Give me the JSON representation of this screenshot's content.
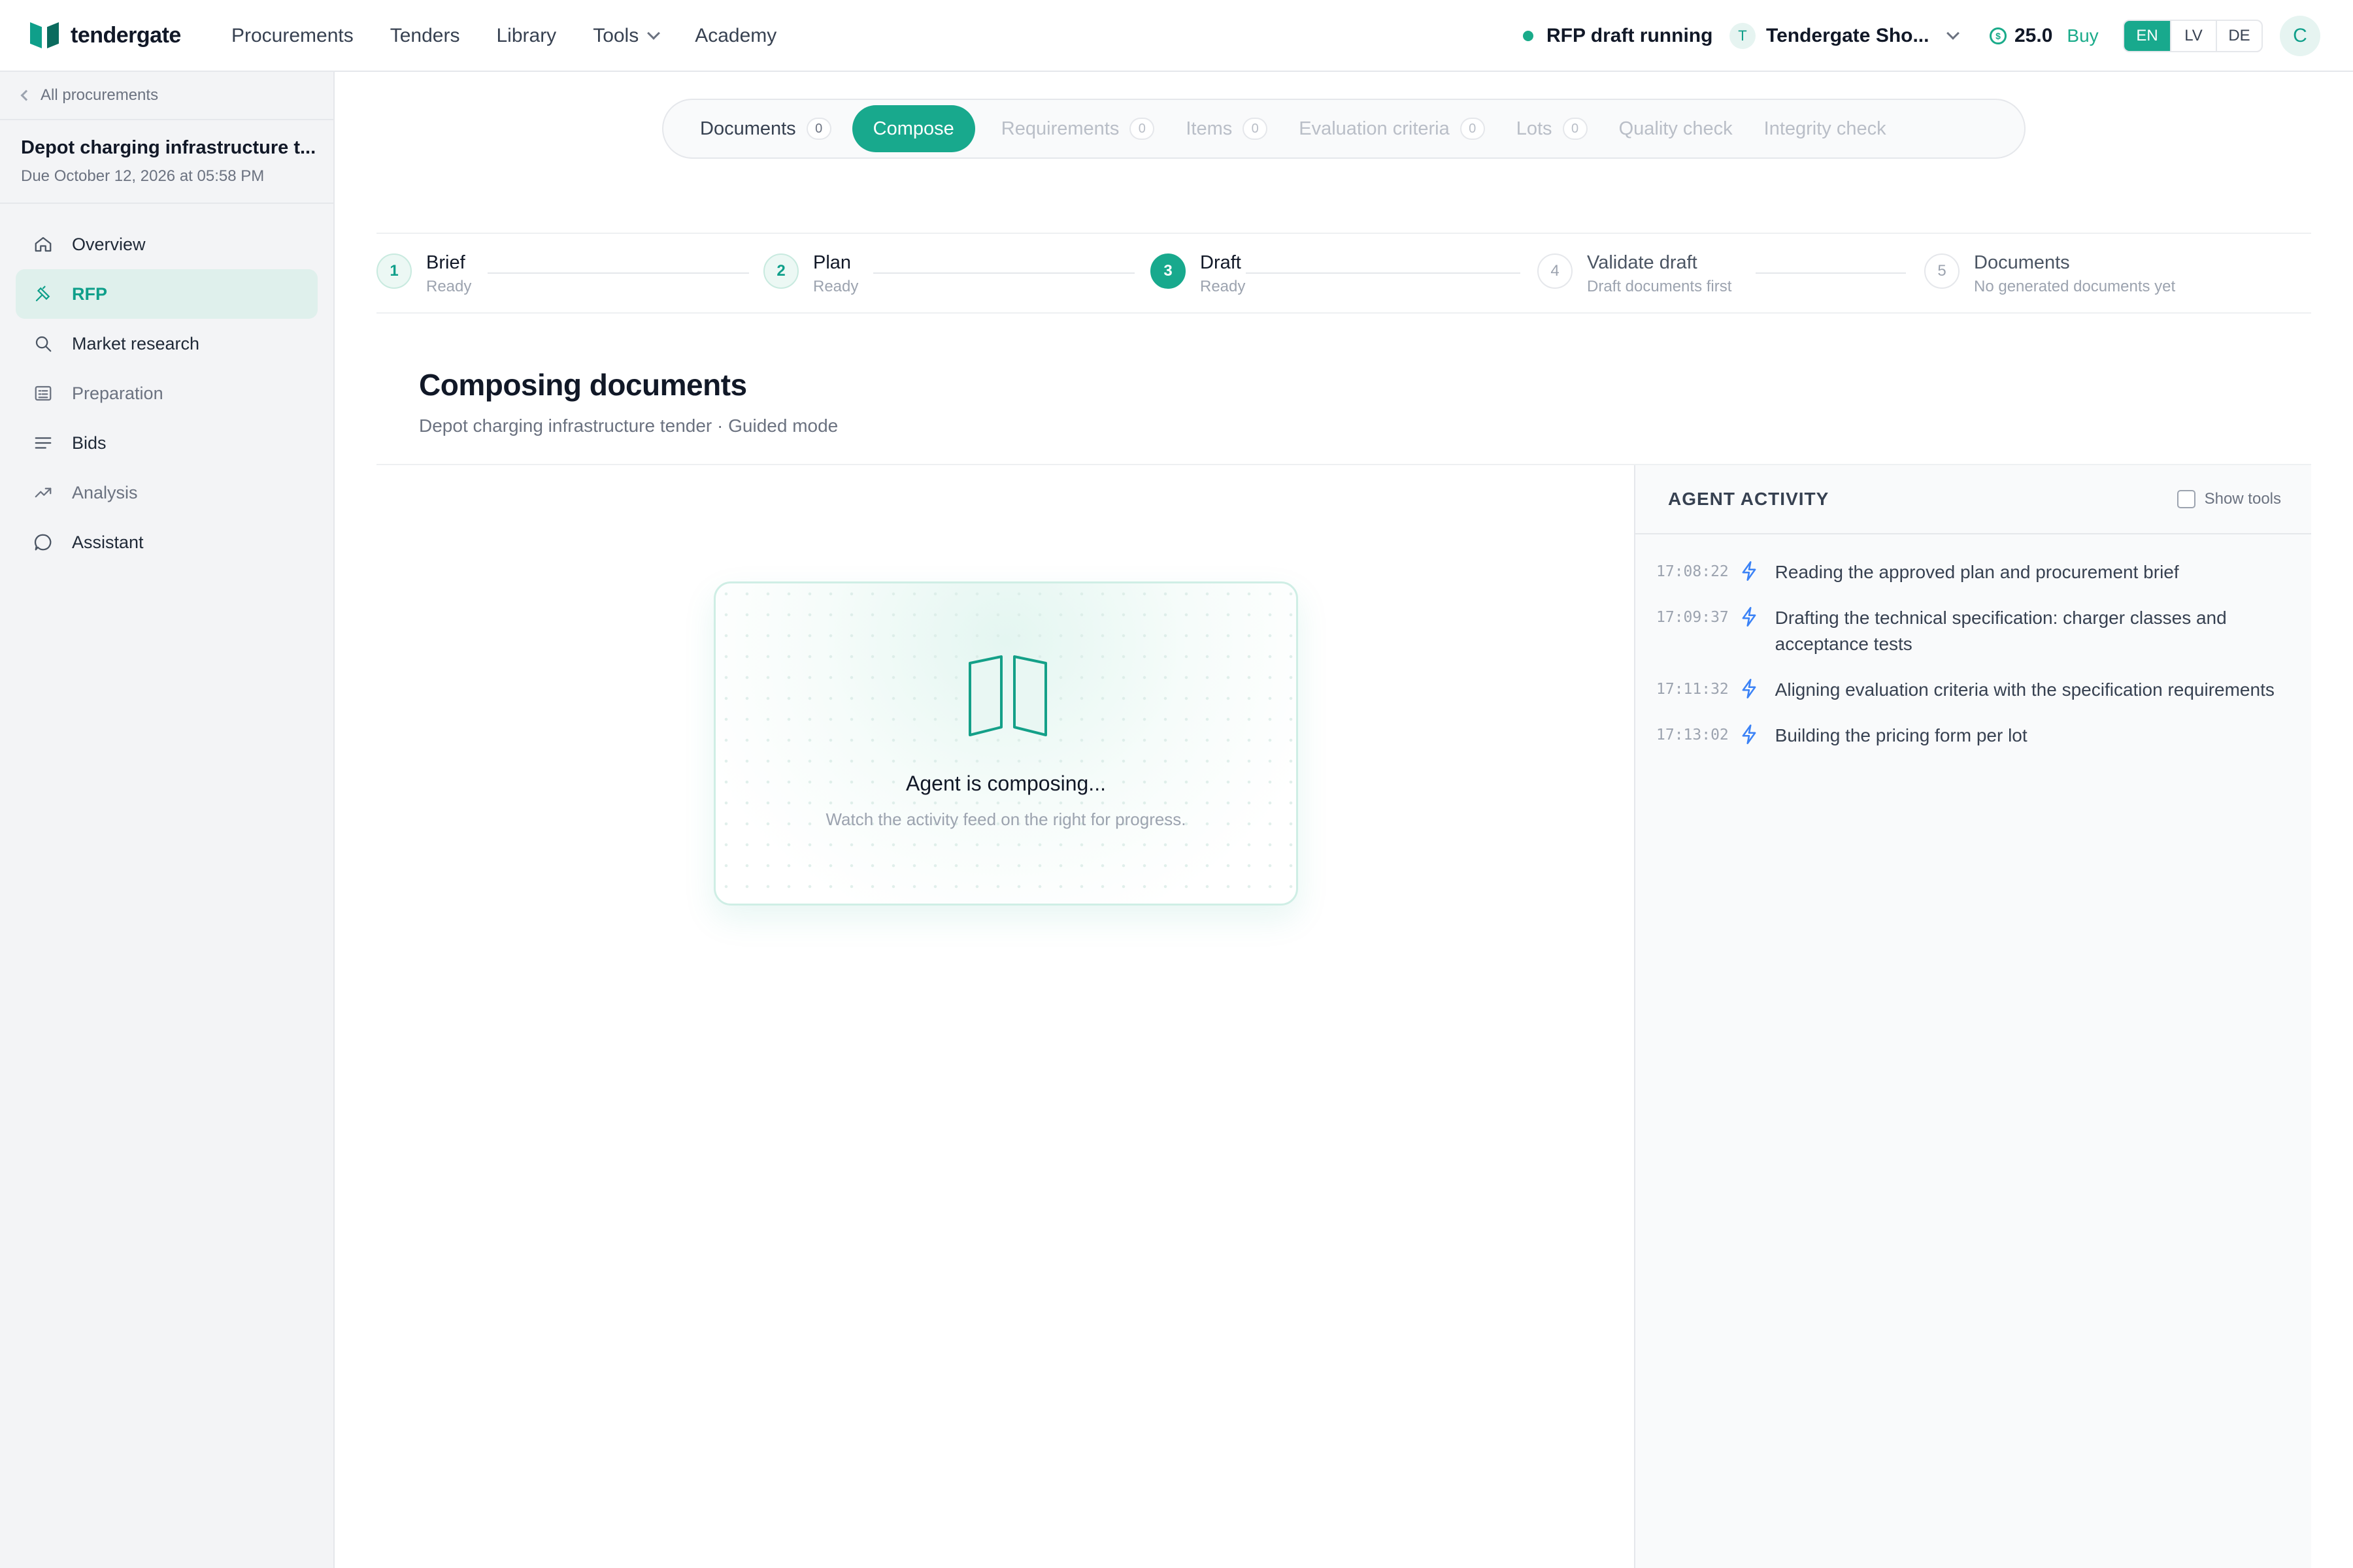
{
  "app": {
    "name": "tendergate"
  },
  "nav": {
    "items": [
      {
        "label": "Procurements"
      },
      {
        "label": "Tenders"
      },
      {
        "label": "Library"
      },
      {
        "label": "Tools"
      },
      {
        "label": "Academy"
      }
    ]
  },
  "header": {
    "status_text": "RFP draft running",
    "org_initial": "T",
    "org_name": "Tendergate Sho...",
    "credits": "25.0",
    "buy_label": "Buy",
    "languages": [
      "EN",
      "LV",
      "DE"
    ],
    "active_language": "EN",
    "user_initial": "C"
  },
  "sidebar": {
    "back_label": "All procurements",
    "project_title": "Depot charging infrastructure t...",
    "project_due": "Due October 12, 2026 at 05:58 PM",
    "items": [
      {
        "label": "Overview",
        "icon": "home-icon"
      },
      {
        "label": "RFP",
        "icon": "pen-icon"
      },
      {
        "label": "Market research",
        "icon": "search-icon"
      },
      {
        "label": "Preparation",
        "icon": "checklist-icon"
      },
      {
        "label": "Bids",
        "icon": "list-icon"
      },
      {
        "label": "Analysis",
        "icon": "trend-icon"
      },
      {
        "label": "Assistant",
        "icon": "chat-icon"
      }
    ]
  },
  "tabs": [
    {
      "label": "Documents",
      "count": "0"
    },
    {
      "label": "Compose"
    },
    {
      "label": "Requirements",
      "count": "0"
    },
    {
      "label": "Items",
      "count": "0"
    },
    {
      "label": "Evaluation criteria",
      "count": "0"
    },
    {
      "label": "Lots",
      "count": "0"
    },
    {
      "label": "Quality check"
    },
    {
      "label": "Integrity check"
    }
  ],
  "steps": [
    {
      "number": "1",
      "title": "Brief",
      "status": "Ready"
    },
    {
      "number": "2",
      "title": "Plan",
      "status": "Ready"
    },
    {
      "number": "3",
      "title": "Draft",
      "status": "Ready"
    },
    {
      "number": "4",
      "title": "Validate draft",
      "status": "Draft documents first"
    },
    {
      "number": "5",
      "title": "Documents",
      "status": "No generated documents yet"
    }
  ],
  "main": {
    "title": "Composing documents",
    "subtitle": "Depot charging infrastructure tender · Guided mode",
    "card_title": "Agent is composing...",
    "card_subtitle": "Watch the activity feed on the right for progress."
  },
  "activity": {
    "title": "AGENT ACTIVITY",
    "show_tools_label": "Show tools",
    "entries": [
      {
        "time": "17:08:22",
        "text": "Reading the approved plan and procurement brief"
      },
      {
        "time": "17:09:37",
        "text": "Drafting the technical specification: charger classes and acceptance tests"
      },
      {
        "time": "17:11:32",
        "text": "Aligning evaluation criteria with the specification requirements"
      },
      {
        "time": "17:13:02",
        "text": "Building the pricing form per lot"
      }
    ]
  },
  "colors": {
    "accent": "#18a98d",
    "accent_dark": "#0b6b5e",
    "active_nav_bg": "#dff0ec",
    "bolt": "#3b82f6"
  }
}
